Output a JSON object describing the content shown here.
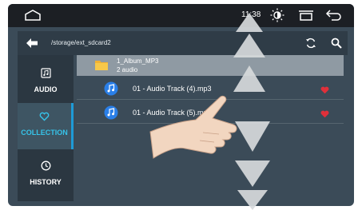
{
  "status_bar": {
    "time": "11:38",
    "icons": [
      "home-icon",
      "brightness-icon",
      "window-icon",
      "back-arrow-icon"
    ]
  },
  "path_bar": {
    "path": "/storage/ext_sdcard2",
    "icons": [
      "back-arrow-icon",
      "refresh-icon",
      "search-icon"
    ]
  },
  "sidebar": {
    "items": [
      {
        "label": "AUDIO",
        "icon": "music-file-icon",
        "active": false
      },
      {
        "label": "COLLECTION",
        "icon": "heart-outline-icon",
        "active": true
      },
      {
        "label": "HISTORY",
        "icon": "clock-icon",
        "active": false
      }
    ]
  },
  "folder": {
    "name": "1_Album_MP3",
    "count": "2 audio"
  },
  "tracks": [
    {
      "title": "01 - Audio Track (4).mp3"
    },
    {
      "title": "01 - Audio Track (5).mp3"
    }
  ],
  "colors": {
    "accent": "#36c4ea",
    "favorite": "#e0303a",
    "background": "#3b4b58",
    "overlay_arrow": "#d7dadc"
  }
}
